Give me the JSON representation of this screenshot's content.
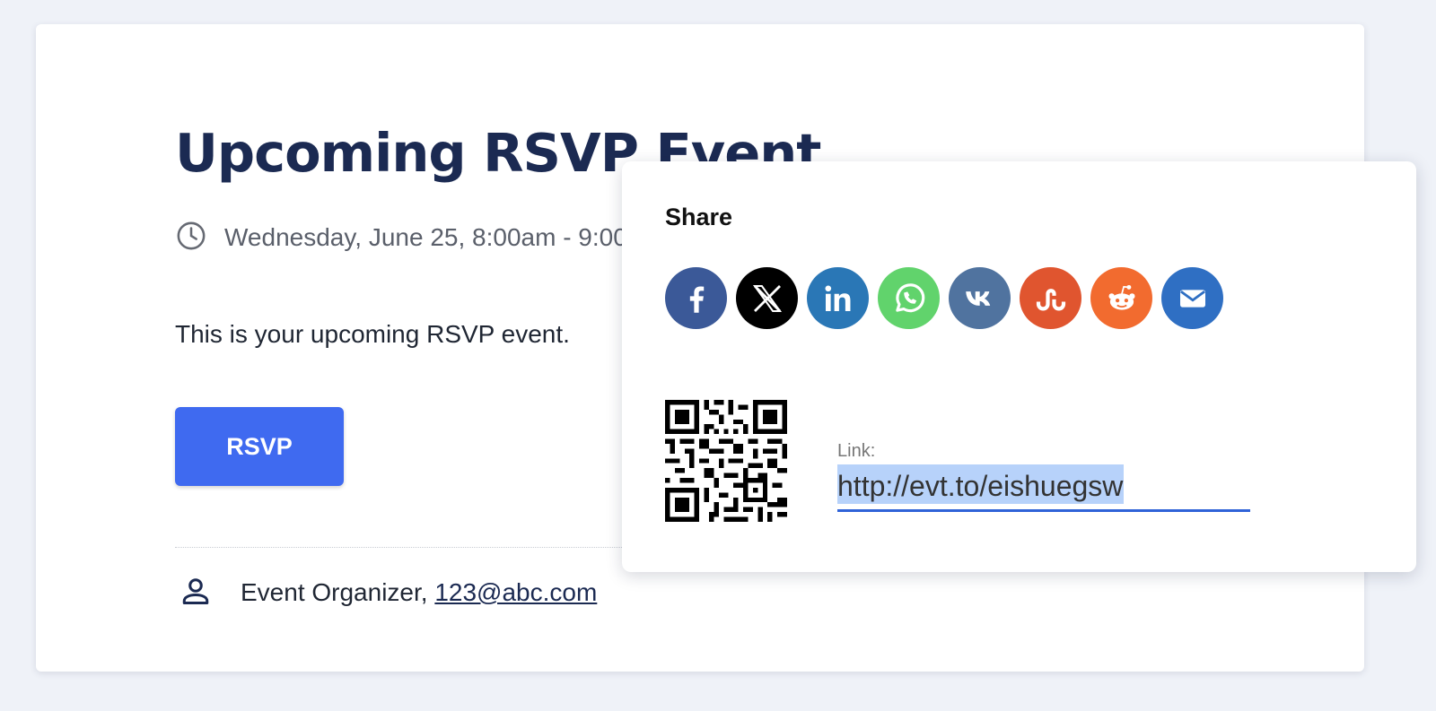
{
  "event": {
    "title": "Upcoming RSVP Event",
    "date": "Wednesday, June 25, 8:00am - 9:00am",
    "description": "This is your upcoming RSVP event.",
    "rsvp_label": "RSVP",
    "organizer_name": "Event Organizer,",
    "organizer_email": "123@abc.com"
  },
  "share": {
    "title": "Share",
    "link_label": "Link:",
    "link_value": "http://evt.to/eishuegsw",
    "networks": [
      {
        "name": "facebook-icon",
        "color": "#3b5998"
      },
      {
        "name": "x-icon",
        "color": "#000000"
      },
      {
        "name": "linkedin-icon",
        "color": "#2a77b6"
      },
      {
        "name": "whatsapp-icon",
        "color": "#61d36c"
      },
      {
        "name": "vk-icon",
        "color": "#50739f"
      },
      {
        "name": "stumbleupon-icon",
        "color": "#e0552f"
      },
      {
        "name": "reddit-icon",
        "color": "#f26b2f"
      },
      {
        "name": "email-icon",
        "color": "#2f6fc3"
      }
    ]
  },
  "colors": {
    "accent": "#3f6af0",
    "title": "#1b2a52",
    "background": "#eff2f8"
  }
}
